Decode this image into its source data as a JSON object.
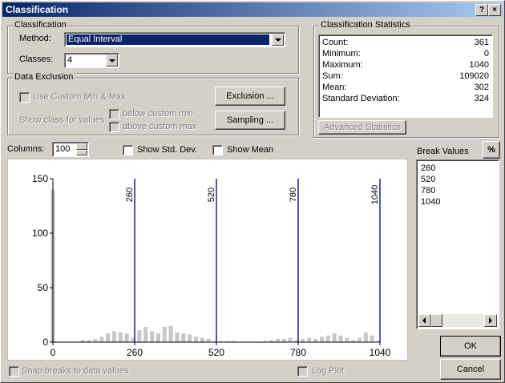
{
  "window": {
    "title": "Classification",
    "help_glyph": "?",
    "close_glyph": "×"
  },
  "classification": {
    "group_label": "Classification",
    "method_label": "Method:",
    "method_value": "Equal Interval",
    "classes_label": "Classes:",
    "classes_value": "4"
  },
  "stats": {
    "group_label": "Classification Statistics",
    "rows": [
      {
        "key": "Count:",
        "value": "361"
      },
      {
        "key": "Minimum:",
        "value": "0"
      },
      {
        "key": "Maximum:",
        "value": "1040"
      },
      {
        "key": "Sum:",
        "value": "109020"
      },
      {
        "key": "Mean:",
        "value": "302"
      },
      {
        "key": "Standard Deviation:",
        "value": "324"
      }
    ],
    "advanced_button": "Advanced Statistics"
  },
  "exclusion": {
    "group_label": "Data Exclusion",
    "use_custom": "Use Custom Min & Max",
    "show_class": "Show class for values:",
    "below": "below custom min",
    "above": "above custom max",
    "exclusion_button": "Exclusion ...",
    "sampling_button": "Sampling ..."
  },
  "controls": {
    "columns_label": "Columns:",
    "columns_value": "100",
    "std_dev": "Show Std. Dev.",
    "mean": "Show Mean",
    "snap": "Snap breaks to data values",
    "log_plot": "Log Plot"
  },
  "breaks": {
    "label": "Break Values",
    "percent_button": "%",
    "values": [
      "260",
      "520",
      "780",
      "1040"
    ]
  },
  "buttons": {
    "ok": "OK",
    "cancel": "Cancel"
  },
  "colors": {
    "title_start": "#0a246a",
    "title_end": "#a6caf0",
    "selection": "#0a246a",
    "break_line": "#1e1e8c",
    "bar": "#c8c8c8"
  },
  "chart_data": {
    "type": "bar",
    "ylim": [
      0,
      150
    ],
    "xlim": [
      0,
      1040
    ],
    "y_ticks": [
      "150",
      "100",
      "50",
      "0"
    ],
    "x_ticks": [
      "0",
      "260",
      "520",
      "780",
      "1040"
    ],
    "breaks": [
      260,
      520,
      780,
      1040
    ],
    "bin_centers": [
      0,
      95,
      115,
      135,
      155,
      175,
      195,
      215,
      235,
      255,
      275,
      295,
      315,
      335,
      355,
      375,
      395,
      415,
      435,
      455,
      475,
      495,
      515,
      535,
      555,
      575,
      675,
      695,
      715,
      735,
      755,
      775,
      795,
      815,
      835,
      855,
      875,
      895,
      915,
      935,
      955,
      975,
      995,
      1015,
      1035
    ],
    "values": [
      140,
      2,
      2,
      3,
      5,
      8,
      10,
      9,
      8,
      4,
      11,
      14,
      10,
      8,
      14,
      15,
      9,
      8,
      7,
      5,
      4,
      3,
      1,
      1,
      1,
      1,
      1,
      2,
      3,
      3,
      4,
      2,
      3,
      4,
      3,
      5,
      6,
      8,
      6,
      4,
      2,
      4,
      9,
      6,
      1
    ]
  }
}
